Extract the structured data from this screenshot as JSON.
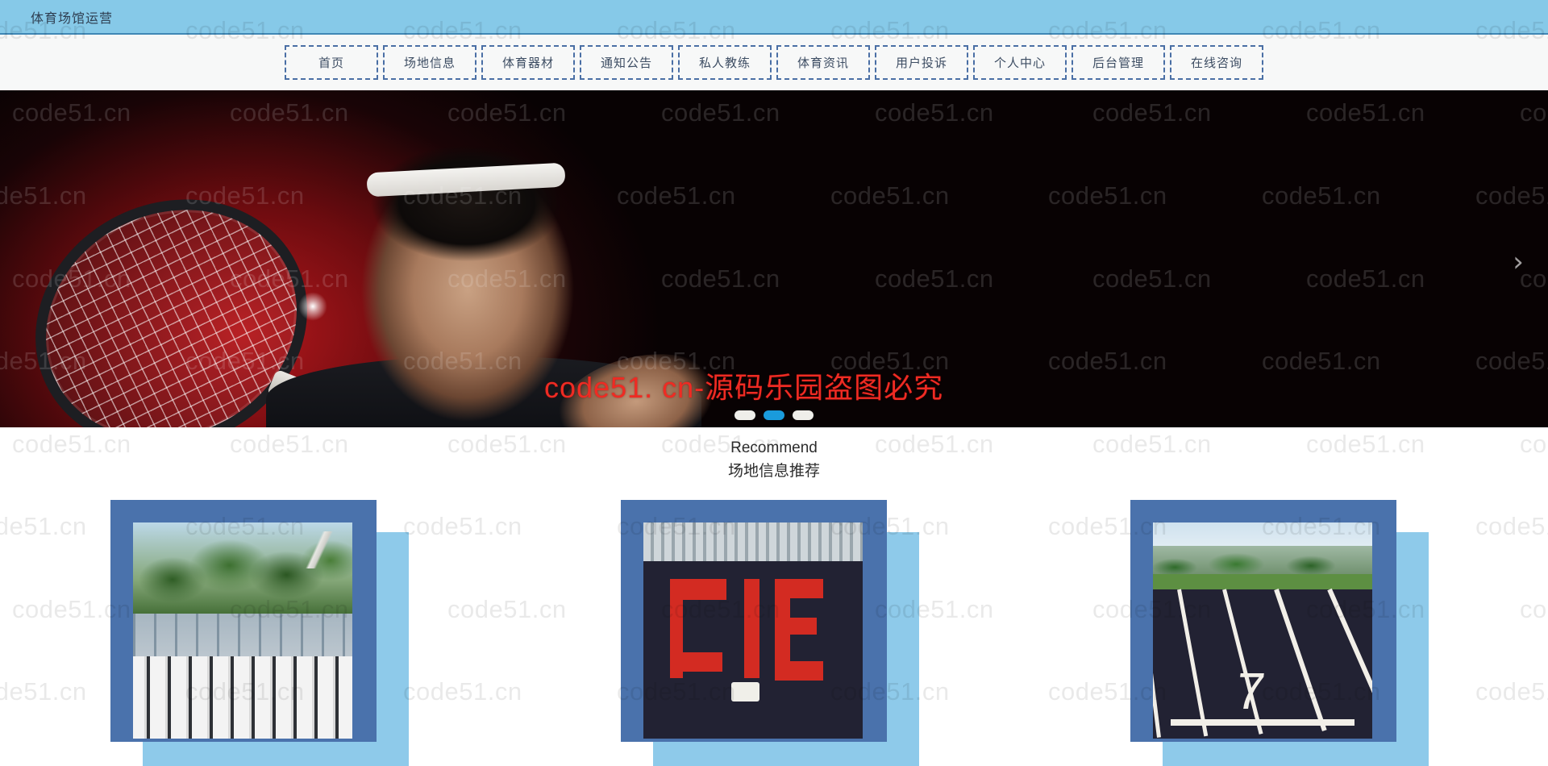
{
  "window": {
    "title": "体育场馆运营"
  },
  "nav": {
    "items": [
      {
        "label": "首页",
        "name": "nav-item-home"
      },
      {
        "label": "场地信息",
        "name": "nav-item-venue-info"
      },
      {
        "label": "体育器材",
        "name": "nav-item-sports-equipment"
      },
      {
        "label": "通知公告",
        "name": "nav-item-announcements"
      },
      {
        "label": "私人教练",
        "name": "nav-item-personal-trainer"
      },
      {
        "label": "体育资讯",
        "name": "nav-item-sports-news"
      },
      {
        "label": "用户投诉",
        "name": "nav-item-user-complaints"
      },
      {
        "label": "个人中心",
        "name": "nav-item-user-center"
      },
      {
        "label": "后台管理",
        "name": "nav-item-admin-panel"
      },
      {
        "label": "在线咨询",
        "name": "nav-item-online-consult"
      }
    ]
  },
  "hero": {
    "watermark_text": "code51. cn-源码乐园盗图必究",
    "next_arrow": "›",
    "dots": [
      {
        "active": false
      },
      {
        "active": true
      },
      {
        "active": false
      }
    ]
  },
  "recommend": {
    "heading_en": "Recommend",
    "heading_cn": "场地信息推荐"
  },
  "cards": [
    {
      "name": "venue-card-1",
      "alt": "group-photo-bleachers"
    },
    {
      "name": "venue-card-2",
      "alt": "aerial-field-formation"
    },
    {
      "name": "venue-card-3",
      "alt": "running-track-lane-7"
    }
  ],
  "watermark": {
    "text": "code51.cn"
  },
  "colors": {
    "header_bg": "#86c9e8",
    "header_border": "#3f87b5",
    "nav_bg": "#f7f8f8",
    "nav_border": "#4a6fa5",
    "card_main": "#4a72ac",
    "card_shadow": "#8ecaea",
    "dot_active": "#1a9bdc",
    "watermark_red": "#ef2b23"
  }
}
